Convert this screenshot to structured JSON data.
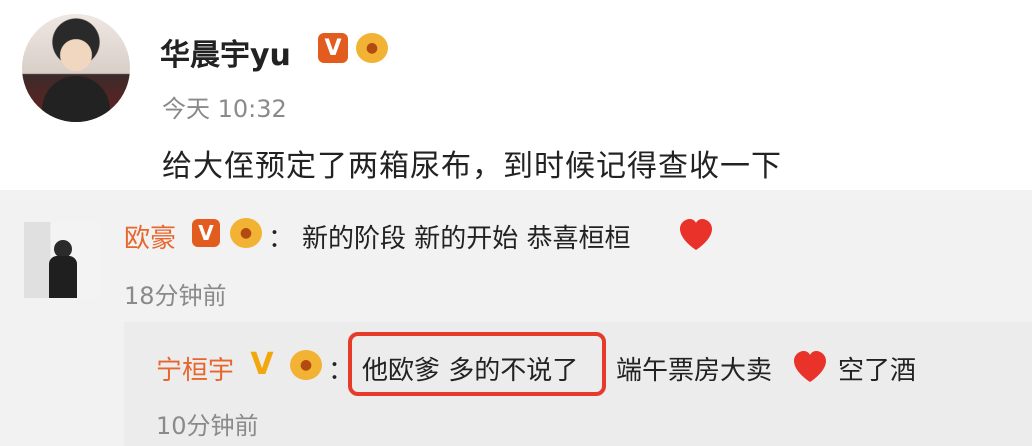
{
  "post": {
    "username": "华晨宇yu",
    "verified_badge": "V",
    "time": "今天 10:32",
    "text": "给大侄预定了两箱尿布，到时候记得查收一下"
  },
  "comment1": {
    "name": "欧豪",
    "verified_badge": "V",
    "colon": "：",
    "text": "新的阶段 新的开始 恭喜桓桓",
    "time": "18分钟前"
  },
  "reply1": {
    "name": "宁桓宇",
    "verified_badge": "V",
    "colon": "：",
    "highlighted_text": "他欧爹 多的不说了",
    "text_after_highlight": "端午票房大卖",
    "text_end": "空了酒",
    "time": "10分钟前"
  },
  "colors": {
    "name_orange": "#e7662d",
    "highlight_red": "#e63a2b",
    "time_gray": "#8a8a8a"
  }
}
